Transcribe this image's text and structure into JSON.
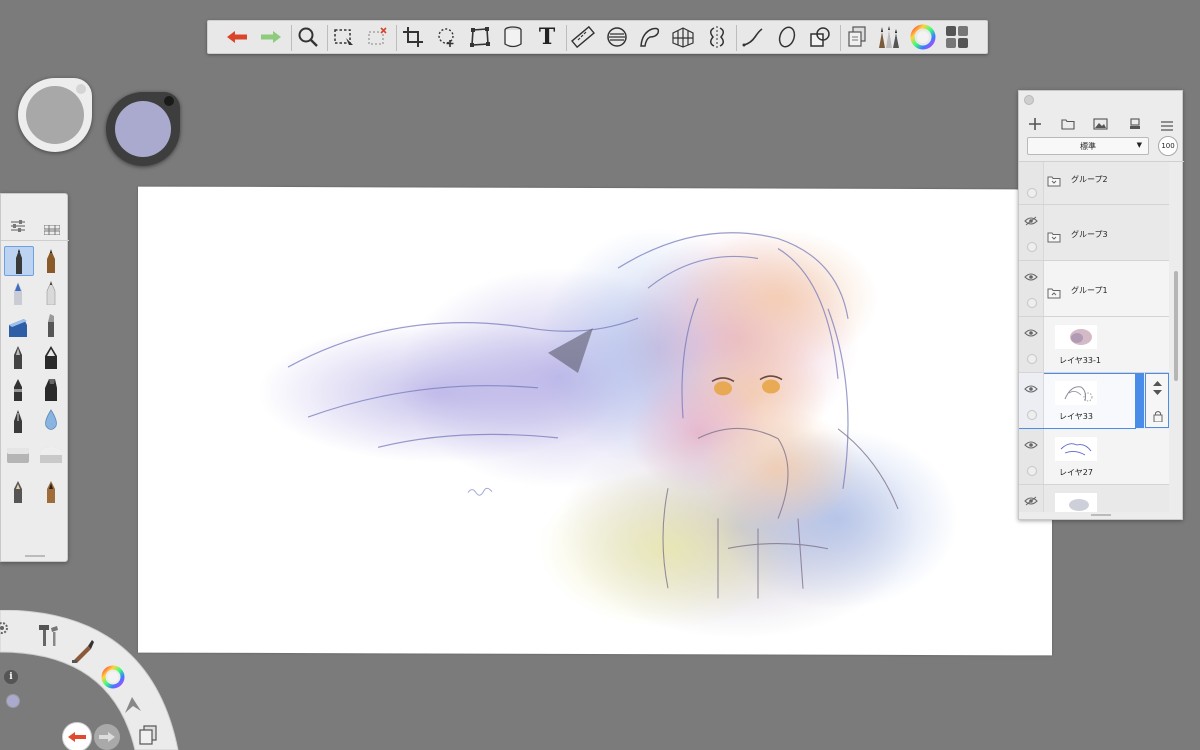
{
  "toolbar": {
    "tools": [
      {
        "icon": "undo-arrow-icon",
        "color": "#d9442b"
      },
      {
        "icon": "redo-arrow-icon",
        "color": "#8ecb7d"
      },
      {
        "icon": "zoom-magnifier-icon"
      },
      {
        "icon": "rect-select-icon"
      },
      {
        "icon": "clear-selection-icon"
      },
      {
        "icon": "crop-icon"
      },
      {
        "icon": "lasso-transform-icon"
      },
      {
        "icon": "distort-transform-icon"
      },
      {
        "icon": "fill-bucket-icon"
      },
      {
        "icon": "text-tool-icon",
        "label": "T"
      },
      {
        "icon": "ruler-icon"
      },
      {
        "icon": "ellipse-guide-icon"
      },
      {
        "icon": "french-curve-icon"
      },
      {
        "icon": "perspective-grid-icon"
      },
      {
        "icon": "symmetry-icon"
      },
      {
        "icon": "stroke-line-icon"
      },
      {
        "icon": "ellipse-shape-icon"
      },
      {
        "icon": "shapes-icon"
      },
      {
        "icon": "layers-copy-icon"
      },
      {
        "icon": "brush-library-icon"
      },
      {
        "icon": "color-wheel-icon"
      },
      {
        "icon": "ui-grid-icon"
      }
    ]
  },
  "pucks": {
    "left_color": "#a8a8a8",
    "right_color": "#a9aacd"
  },
  "brushes": [
    "pencil-brush-icon",
    "marker-brush-icon",
    "airbrush-icon",
    "fineliner-icon",
    "chisel-marker-icon",
    "paint-brush-icon",
    "pen-icon",
    "ballpoint-icon",
    "felt-tip-icon",
    "highlighter-icon",
    "fountain-pen-icon",
    "water-drop-icon",
    "hard-eraser-icon",
    "soft-eraser-icon",
    "pencil-small-icon",
    "crayon-icon"
  ],
  "layers": {
    "blend_mode": "標準",
    "opacity": "100",
    "rows": [
      {
        "name": "グループ2",
        "type": "group",
        "visible": false
      },
      {
        "name": "グループ3",
        "type": "group",
        "visible": false
      },
      {
        "name": "グループ1",
        "type": "group",
        "visible": true
      },
      {
        "name": "レイヤ33-1",
        "type": "layer",
        "visible": true
      },
      {
        "name": "レイヤ33",
        "type": "layer",
        "visible": true,
        "selected": true
      },
      {
        "name": "レイヤ27",
        "type": "layer",
        "visible": true
      },
      {
        "name": "",
        "type": "layer",
        "visible": false
      }
    ]
  },
  "lagoon": {
    "accent_color": "#e04a2f",
    "items": [
      "settings-gear-icon",
      "tools-hammer-icon",
      "brush-set-icon",
      "color-wheel-icon",
      "info-icon",
      "selection-arrow-icon",
      "copy-icon",
      "undo-icon",
      "redo-icon"
    ]
  }
}
